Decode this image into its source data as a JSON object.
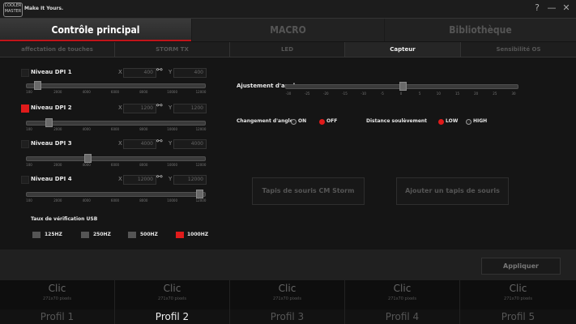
{
  "app": {
    "logo_line1": "COOLER",
    "logo_line2": "MASTER",
    "tagline": "Make It Yours.",
    "help_glyph": "?",
    "minimize_glyph": "—",
    "close_glyph": "✕"
  },
  "main_tabs": [
    "Contrôle principal",
    "MACRO",
    "Bibliothèque"
  ],
  "sub_tabs": [
    "affectation de touches",
    "STORM TX",
    "LED",
    "Capteur",
    "Sensibilité OS"
  ],
  "dpi_slider_ticks": [
    "100",
    "2000",
    "4000",
    "6000",
    "8000",
    "10000",
    "12000"
  ],
  "dpi_levels": [
    {
      "label": "Niveau DPI 1",
      "checked": false,
      "x": "400",
      "y": "400",
      "slider_value": 400
    },
    {
      "label": "Niveau DPI 2",
      "checked": true,
      "x": "1200",
      "y": "1200",
      "slider_value": 1200
    },
    {
      "label": "Niveau DPI 3",
      "checked": false,
      "x": "4000",
      "y": "4000",
      "slider_value": 4000
    },
    {
      "label": "Niveau DPI 4",
      "checked": false,
      "x": "12000",
      "y": "12000",
      "slider_value": 12000
    }
  ],
  "axis_x": "X",
  "axis_y": "Y",
  "link_glyph": "⚯",
  "usb": {
    "title": "Taux de vérification USB",
    "options": [
      {
        "label": "125HZ",
        "selected": false
      },
      {
        "label": "250HZ",
        "selected": false
      },
      {
        "label": "500HZ",
        "selected": false
      },
      {
        "label": "1000HZ",
        "selected": true
      }
    ]
  },
  "angle_adjust": {
    "label": "Ajustement d'angle",
    "ticks": [
      "-30",
      "-25",
      "-20",
      "-15",
      "-10",
      "-5",
      "0",
      "5",
      "10",
      "15",
      "20",
      "25",
      "30"
    ],
    "value": 0
  },
  "angle_change": {
    "label": "Changement d'angle",
    "options": [
      {
        "label": "ON",
        "selected": false
      },
      {
        "label": "OFF",
        "selected": true
      }
    ]
  },
  "lift_distance": {
    "label": "Distance soulèvement",
    "options": [
      {
        "label": "LOW",
        "selected": true
      },
      {
        "label": "HIGH",
        "selected": false
      }
    ]
  },
  "buttons": {
    "storm_pad": "Tapis de souris CM Storm",
    "add_pad": "Ajouter un tapis de souris",
    "apply": "Appliquer"
  },
  "profiles": [
    {
      "clic": "Clic",
      "size": "271x70 pixels",
      "name": "Profil 1",
      "active": false
    },
    {
      "clic": "Clic",
      "size": "271x70 pixels",
      "name": "Profil 2",
      "active": true
    },
    {
      "clic": "Clic",
      "size": "271x70 pixels",
      "name": "Profil 3",
      "active": false
    },
    {
      "clic": "Clic",
      "size": "271x70 pixels",
      "name": "Profil 4",
      "active": false
    },
    {
      "clic": "Clic",
      "size": "271x70 pixels",
      "name": "Profil 5",
      "active": false
    }
  ],
  "colors": {
    "accent": "#e01b1b",
    "background": "#141414"
  }
}
